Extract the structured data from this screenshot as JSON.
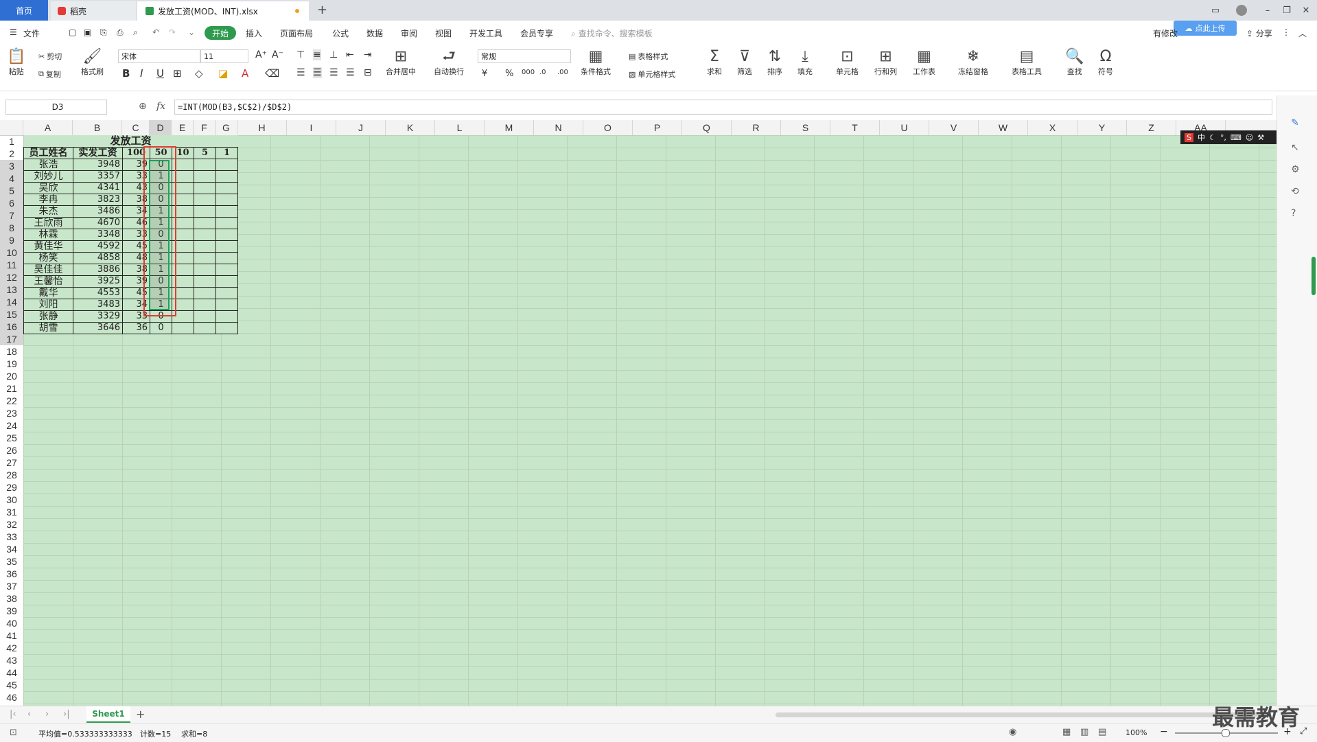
{
  "titlebar": {
    "home_tab": "首页",
    "daoke_tab": "稻壳",
    "file_tab": "发放工资(MOD、INT).xlsx",
    "new_tab_symbol": "+"
  },
  "menu": {
    "file": "文件",
    "start": "开始",
    "insert": "插入",
    "layout": "页面布局",
    "formula": "公式",
    "data": "数据",
    "review": "审阅",
    "view": "视图",
    "dev": "开发工具",
    "member": "会员专享",
    "search_placeholder": "查找命令、搜索模板",
    "share": "分享",
    "unsynced": "有修改",
    "cloud": "点此上传"
  },
  "ribbon": {
    "paste": "粘贴",
    "cut": "剪切",
    "copy": "复制",
    "format_painter": "格式刷",
    "font_name": "宋体",
    "font_size": "11",
    "merge_center": "合并居中",
    "wrap": "自动换行",
    "number_format": "常规",
    "cond_format": "条件格式",
    "table_style": "表格样式",
    "cell_style": "单元格样式",
    "sum": "求和",
    "filter": "筛选",
    "sort": "排序",
    "fill": "填充",
    "cell": "单元格",
    "row_col": "行和列",
    "worksheet": "工作表",
    "freeze": "冻结窗格",
    "table_tools": "表格工具",
    "find": "查找",
    "symbol": "符号"
  },
  "formula_bar": {
    "name_box": "D3",
    "fx": "fx",
    "formula": "=INT(MOD(B3,$C$2)/$D$2)"
  },
  "columns": [
    "A",
    "B",
    "C",
    "D",
    "E",
    "F",
    "G",
    "H",
    "I",
    "J",
    "K",
    "L",
    "M",
    "N",
    "O",
    "P",
    "Q",
    "R",
    "S",
    "T",
    "U",
    "V",
    "W",
    "X",
    "Y",
    "Z",
    "AA"
  ],
  "row_numbers": [
    "1",
    "2",
    "3",
    "4",
    "5",
    "6",
    "7",
    "8",
    "9",
    "10",
    "11",
    "12",
    "13",
    "14",
    "15",
    "16",
    "17",
    "18",
    "19",
    "20",
    "21",
    "22",
    "23",
    "24",
    "25",
    "26",
    "27",
    "28",
    "29",
    "30",
    "31",
    "32",
    "33",
    "34",
    "35",
    "36",
    "37",
    "38",
    "39",
    "40",
    "41",
    "42",
    "43",
    "44",
    "45",
    "46"
  ],
  "sheet": {
    "title": "发放工资",
    "header": [
      "员工姓名",
      "实发工资",
      "100",
      "50",
      "10",
      "5",
      "1"
    ],
    "rows": [
      [
        "张浩",
        "3948",
        "39",
        "0"
      ],
      [
        "刘妙儿",
        "3357",
        "33",
        "1"
      ],
      [
        "吴欣",
        "4341",
        "43",
        "0"
      ],
      [
        "李冉",
        "3823",
        "38",
        "0"
      ],
      [
        "朱杰",
        "3486",
        "34",
        "1"
      ],
      [
        "王欣雨",
        "4670",
        "46",
        "1"
      ],
      [
        "林霖",
        "3348",
        "33",
        "0"
      ],
      [
        "黄佳华",
        "4592",
        "45",
        "1"
      ],
      [
        "杨笑",
        "4858",
        "48",
        "1"
      ],
      [
        "吴佳佳",
        "3886",
        "38",
        "1"
      ],
      [
        "王馨怡",
        "3925",
        "39",
        "0"
      ],
      [
        "戴华",
        "4553",
        "45",
        "1"
      ],
      [
        "刘阳",
        "3483",
        "34",
        "1"
      ],
      [
        "张静",
        "3329",
        "33",
        "0"
      ],
      [
        "胡雪",
        "3646",
        "36",
        "0"
      ]
    ]
  },
  "sheet_tabs": {
    "active": "Sheet1",
    "add": "+"
  },
  "status": {
    "average": "平均值=0.533333333333",
    "count": "计数=15",
    "sum": "求和=8",
    "zoom": "100%",
    "ime": "中"
  },
  "watermark": "最需教育",
  "colors": {
    "accent_green": "#2e9a4e",
    "home_tab_blue": "#2f6fd4",
    "cell_bg": "#c8e6c9",
    "highlight_red": "#e53935",
    "selection_green": "#1aa35a"
  }
}
